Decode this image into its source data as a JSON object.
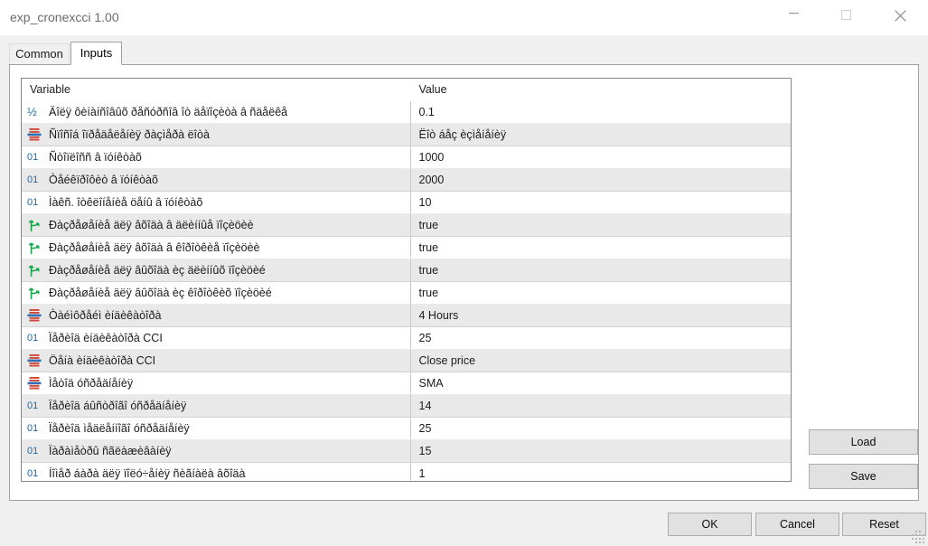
{
  "window": {
    "title": "exp_cronexcci 1.00",
    "controls": [
      {
        "name": "minimize-button",
        "glyph": "minimize"
      },
      {
        "name": "maximize-button",
        "glyph": "maximize"
      },
      {
        "name": "close-button",
        "glyph": "close"
      }
    ]
  },
  "tabs": [
    {
      "label": "Common",
      "active": false
    },
    {
      "label": "Inputs",
      "active": true
    }
  ],
  "table": {
    "headers": {
      "variable": "Variable",
      "value": "Value"
    },
    "rows": [
      {
        "icon": "fraction-half-icon",
        "icon_type": "double",
        "variable": "Äîëÿ ôèíàíñîâûõ ðåñóðñîâ îò äåïîçèòà â ñäåëêå",
        "value": "0.1"
      },
      {
        "icon": "enum-list-icon",
        "icon_type": "enum",
        "variable": "Ñïîñîá îïðåäåëåíèÿ ðàçìåðà ëîòà",
        "value": "Ëîò áåç èçìåíåíèÿ"
      },
      {
        "icon": "integer-01-icon",
        "icon_type": "int",
        "variable": "Ñòîïëîññ â ïóíêòàõ",
        "value": "1000"
      },
      {
        "icon": "integer-01-icon",
        "icon_type": "int",
        "variable": "Òåéêïðîôèò â ïóíêòàõ",
        "value": "2000"
      },
      {
        "icon": "integer-01-icon",
        "icon_type": "int",
        "variable": "Ìàêñ. îòêëîíåíèå öåíû â ïóíêòàõ",
        "value": "10"
      },
      {
        "icon": "boolean-branch-icon",
        "icon_type": "bool",
        "variable": "Ðàçðåøåíèå äëÿ âõîäà â äëèííûå ïîçèöèè",
        "value": "true"
      },
      {
        "icon": "boolean-branch-icon",
        "icon_type": "bool",
        "variable": "Ðàçðåøåíèå äëÿ âõîäà â êîðîòêèå ïîçèöèè",
        "value": "true"
      },
      {
        "icon": "boolean-branch-icon",
        "icon_type": "bool",
        "variable": "Ðàçðåøåíèå äëÿ âûõîäà èç äëèííûõ ïîçèöèé",
        "value": "true"
      },
      {
        "icon": "boolean-branch-icon",
        "icon_type": "bool",
        "variable": "Ðàçðåøåíèå äëÿ âûõîäà èç êîðîòêèõ ïîçèöèé",
        "value": "true"
      },
      {
        "icon": "enum-list-icon",
        "icon_type": "enum",
        "variable": "Òàéìôðåéì èíäèêàòîðà",
        "value": "4 Hours"
      },
      {
        "icon": "integer-01-icon",
        "icon_type": "int",
        "variable": "Ïåðèîä èíäèêàòîðà CCI",
        "value": "25"
      },
      {
        "icon": "enum-list-icon",
        "icon_type": "enum",
        "variable": "Öåíà èíäèêàòîðà CCI",
        "value": "Close price"
      },
      {
        "icon": "enum-list-icon",
        "icon_type": "enum",
        "variable": "Ìåòîä óñðåäíåíèÿ",
        "value": "SMA"
      },
      {
        "icon": "integer-01-icon",
        "icon_type": "int",
        "variable": "Ïåðèîä áûñòðîãî óñðåäíåíèÿ",
        "value": "14"
      },
      {
        "icon": "integer-01-icon",
        "icon_type": "int",
        "variable": "Ïåðèîä ìåäëåííîãî óñðåäíåíèÿ",
        "value": "25"
      },
      {
        "icon": "integer-01-icon",
        "icon_type": "int",
        "variable": "Ïàðàìåòðû ñãëàæèâàíèÿ",
        "value": "15"
      },
      {
        "icon": "integer-01-icon",
        "icon_type": "int",
        "variable": "Íîìåð áàðà äëÿ ïîëó÷åíèÿ ñèãíàëà âõîäà",
        "value": "1"
      }
    ]
  },
  "side_buttons": {
    "load": "Load",
    "save": "Save"
  },
  "bottom_buttons": {
    "ok": "OK",
    "cancel": "Cancel",
    "reset": "Reset"
  },
  "colors": {
    "window_bg": "#f0f0f0",
    "panel_bg": "#ffffff",
    "alt_row": "#e9e9e9",
    "button_face": "#e1e1e1",
    "button_border": "#adadad",
    "int_icon": "#1769aa",
    "bool_icon": "#18a24a",
    "enum_icon_red": "#d04a3c",
    "enum_icon_blue": "#2f6fb5",
    "title_text": "#6b6b6b"
  }
}
